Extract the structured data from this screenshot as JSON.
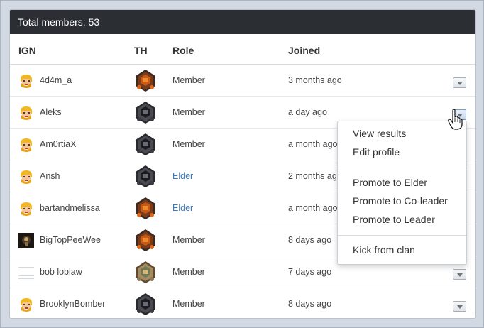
{
  "header": {
    "title": "Total members: 53"
  },
  "columns": {
    "ign": "IGN",
    "th": "TH",
    "role": "Role",
    "joined": "Joined"
  },
  "rows": [
    {
      "ign": "4d4m_a",
      "avatar": "barbarian-icon",
      "th": "th10-icon",
      "role": "Member",
      "joined": "3 months ago"
    },
    {
      "ign": "Aleks",
      "avatar": "barbarian-icon",
      "th": "th9-icon",
      "role": "Member",
      "joined": "a day ago"
    },
    {
      "ign": "Am0rtiaX",
      "avatar": "barbarian-icon",
      "th": "th9-icon",
      "role": "Member",
      "joined": "a month ago"
    },
    {
      "ign": "Ansh",
      "avatar": "barbarian-icon",
      "th": "th9-icon",
      "role": "Elder",
      "joined": "2 months ago"
    },
    {
      "ign": "bartandmelissa",
      "avatar": "barbarian-icon",
      "th": "th10-icon",
      "role": "Elder",
      "joined": "a month ago"
    },
    {
      "ign": "BigTopPeeWee",
      "avatar": "custom-avatar-icon",
      "th": "th10-icon",
      "role": "Member",
      "joined": "8 days ago"
    },
    {
      "ign": "bob loblaw",
      "avatar": "placeholder-avatar-icon",
      "th": "th8-icon",
      "role": "Member",
      "joined": "7 days ago"
    },
    {
      "ign": "BrooklynBomber",
      "avatar": "barbarian-icon",
      "th": "th9-icon",
      "role": "Member",
      "joined": "8 days ago"
    }
  ],
  "menu": {
    "view_results": "View results",
    "edit_profile": "Edit profile",
    "promote_elder": "Promote to Elder",
    "promote_coleader": "Promote to Co-leader",
    "promote_leader": "Promote to Leader",
    "kick": "Kick from clan"
  },
  "colors": {
    "header_bg": "#2b2f33",
    "elder_role": "#3b79b8",
    "page_bg": "#d2d9e2"
  }
}
